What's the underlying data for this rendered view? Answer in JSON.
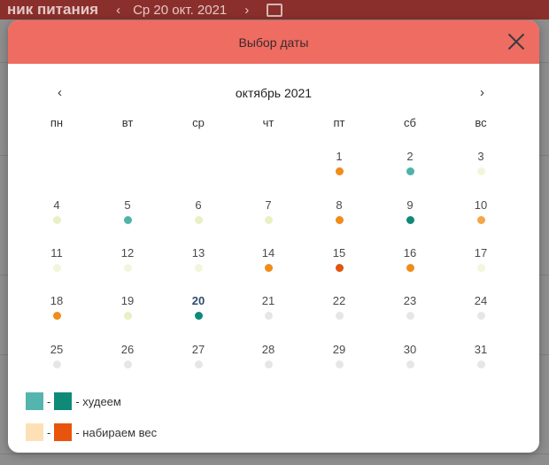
{
  "background": {
    "app_title": "ник питания",
    "nav_prev": "‹",
    "nav_next": "›",
    "current_date": "Ср 20 окт. 2021"
  },
  "dialog": {
    "title": "Выбор даты",
    "month_label": "октябрь 2021",
    "prev_symbol": "‹",
    "next_symbol": "›",
    "weekdays": [
      "пн",
      "вт",
      "ср",
      "чт",
      "пт",
      "сб",
      "вс"
    ],
    "start_weekday_index": 4,
    "today": "20",
    "days": [
      {
        "day": "1",
        "status": "orange"
      },
      {
        "day": "2",
        "status": "teal"
      },
      {
        "day": "3",
        "status": "pale"
      },
      {
        "day": "4",
        "status": "lime"
      },
      {
        "day": "5",
        "status": "teal"
      },
      {
        "day": "6",
        "status": "lime"
      },
      {
        "day": "7",
        "status": "lime"
      },
      {
        "day": "8",
        "status": "orange"
      },
      {
        "day": "9",
        "status": "dark-teal"
      },
      {
        "day": "10",
        "status": "light-orange"
      },
      {
        "day": "11",
        "status": "pale"
      },
      {
        "day": "12",
        "status": "pale"
      },
      {
        "day": "13",
        "status": "pale"
      },
      {
        "day": "14",
        "status": "orange"
      },
      {
        "day": "15",
        "status": "dark-orange"
      },
      {
        "day": "16",
        "status": "orange"
      },
      {
        "day": "17",
        "status": "pale"
      },
      {
        "day": "18",
        "status": "orange"
      },
      {
        "day": "19",
        "status": "lime"
      },
      {
        "day": "20",
        "status": "dark-teal"
      },
      {
        "day": "21",
        "status": "empty"
      },
      {
        "day": "22",
        "status": "empty"
      },
      {
        "day": "23",
        "status": "empty"
      },
      {
        "day": "24",
        "status": "empty"
      },
      {
        "day": "25",
        "status": "empty"
      },
      {
        "day": "26",
        "status": "empty"
      },
      {
        "day": "27",
        "status": "empty"
      },
      {
        "day": "28",
        "status": "empty"
      },
      {
        "day": "29",
        "status": "empty"
      },
      {
        "day": "30",
        "status": "empty"
      },
      {
        "day": "31",
        "status": "empty"
      }
    ],
    "status_colors": {
      "orange": "#ef8c1a",
      "light-orange": "#f3a64a",
      "dark-orange": "#e0550f",
      "teal": "#4fb3a9",
      "dark-teal": "#0f8a78",
      "lime": "#e8f0c4",
      "pale": "#f3f6dc",
      "empty": "#e6e6e6"
    },
    "legend": {
      "separator": "-",
      "lose": {
        "text": "- худеем",
        "color_from": "#53b5ae",
        "color_to": "#0f8a78"
      },
      "gain": {
        "text": "- набираем вес",
        "color_from": "#fde0b5",
        "color_to": "#e9540c"
      }
    }
  }
}
